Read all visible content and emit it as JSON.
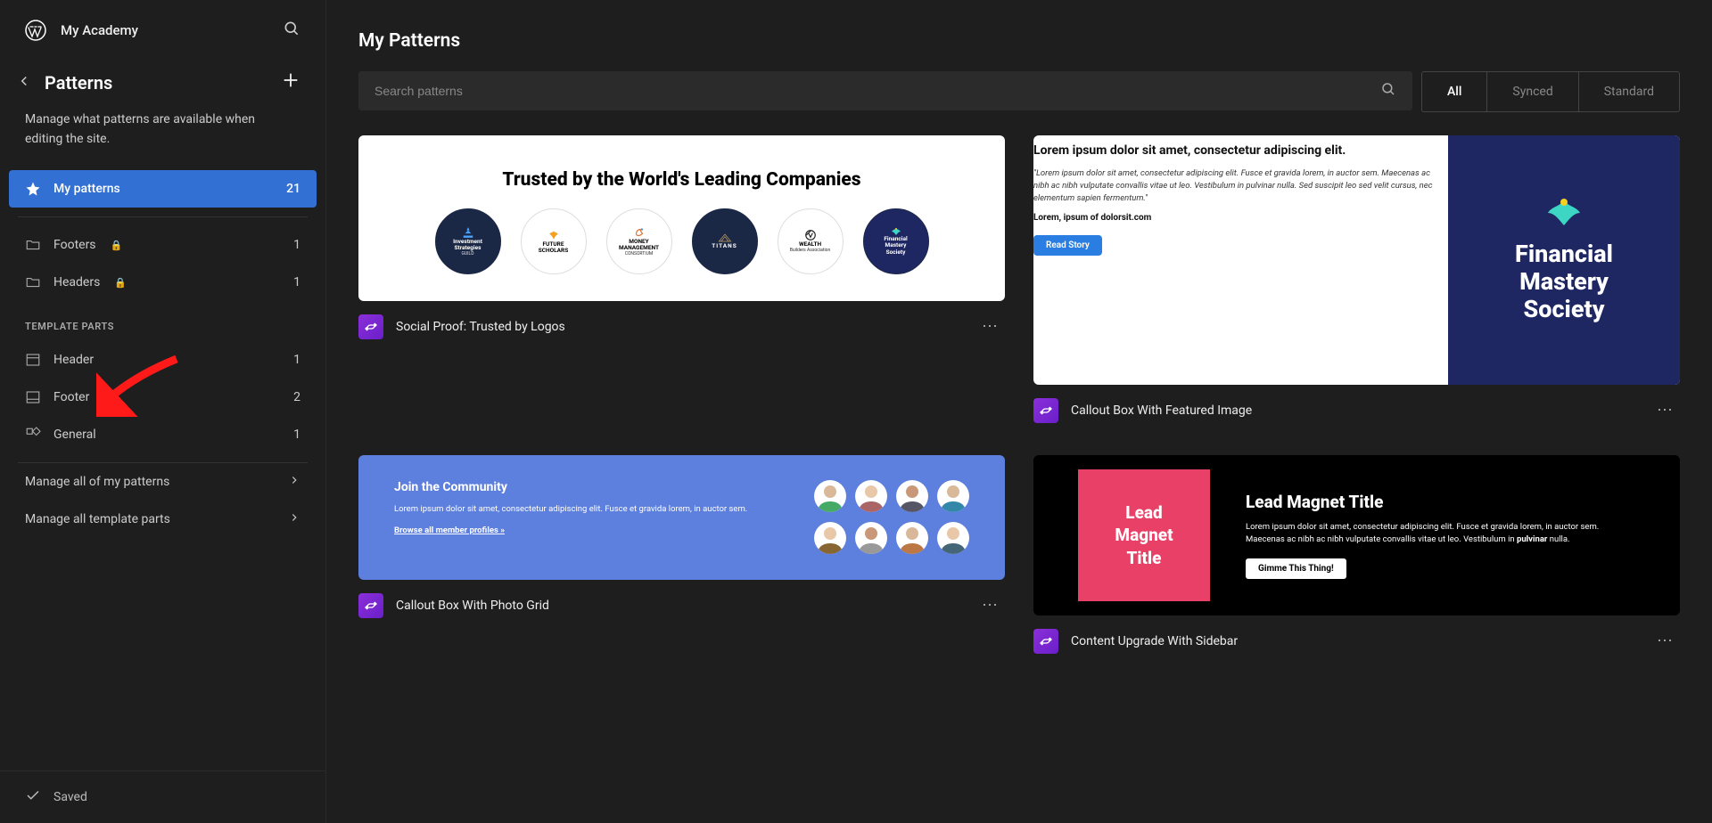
{
  "site": {
    "title": "My Academy"
  },
  "sidebar": {
    "title": "Patterns",
    "description": "Manage what patterns are available when editing the site.",
    "categories": {
      "my_patterns": {
        "label": "My patterns",
        "count": "21"
      },
      "footers": {
        "label": "Footers",
        "count": "1"
      },
      "headers": {
        "label": "Headers",
        "count": "1"
      }
    },
    "template_parts_heading": "TEMPLATE PARTS",
    "template_parts": {
      "header": {
        "label": "Header",
        "count": "1"
      },
      "footer": {
        "label": "Footer",
        "count": "2"
      },
      "general": {
        "label": "General",
        "count": "1"
      }
    },
    "manage_my_patterns": "Manage all of my patterns",
    "manage_template_parts": "Manage all template parts",
    "saved": "Saved"
  },
  "main": {
    "title": "My Patterns",
    "search_placeholder": "Search patterns",
    "filters": {
      "all": "All",
      "synced": "Synced",
      "standard": "Standard"
    },
    "patterns": {
      "p1": {
        "title": "Social Proof: Trusted by Logos",
        "heading": "Trusted by the World's Leading Companies",
        "logos": {
          "l1a": "Investment",
          "l1b": "Strategies",
          "l1c": "GUILD",
          "l2a": "FUTURE",
          "l2b": "SCHOLARS",
          "l3a": "MONEY",
          "l3b": "MANAGEMENT",
          "l3c": "CONSORTIUM",
          "l4a": "TITANS",
          "l5a": "WEALTH",
          "l5b": "Builders Association",
          "l6a": "Financial",
          "l6b": "Mastery",
          "l6c": "Society"
        }
      },
      "p2": {
        "title": "Callout Box With Featured Image",
        "heading": "Lorem ipsum dolor sit amet, consectetur adipiscing elit.",
        "quote": "\"Lorem ipsum dolor sit amet, consectetur adipiscing elit. Fusce et gravida lorem, in auctor sem. Maecenas ac nibh ac nibh vulputate convallis vitae ut leo. Vestibulum in pulvinar nulla. Sed suscipit leo sed velit cursus, nec elementum sapien fermentum.\"",
        "attrib": "Lorem, ipsum of dolorsit.com",
        "button": "Read Story",
        "brand_a": "Financial",
        "brand_b": "Mastery",
        "brand_c": "Society"
      },
      "p3": {
        "title": "Callout Box With Photo Grid",
        "heading": "Join the Community",
        "body": "Lorem ipsum dolor sit amet, consectetur adipiscing elit. Fusce et gravida lorem, in auctor sem.",
        "link": "Browse all member profiles »"
      },
      "p4": {
        "title": "Content Upgrade With Sidebar",
        "box_a": "Lead",
        "box_b": "Magnet",
        "box_c": "Title",
        "heading": "Lead Magnet Title",
        "body_a": "Lorem ipsum dolor sit amet, consectetur adipiscing elit. Fusce et gravida lorem, in auctor sem. Maecenas ac nibh ac nibh vulputate convallis vitae ut leo. Vestibulum in ",
        "body_b": "pulvinar",
        "body_c": " nulla.",
        "button": "Gimme This Thing!"
      }
    }
  }
}
